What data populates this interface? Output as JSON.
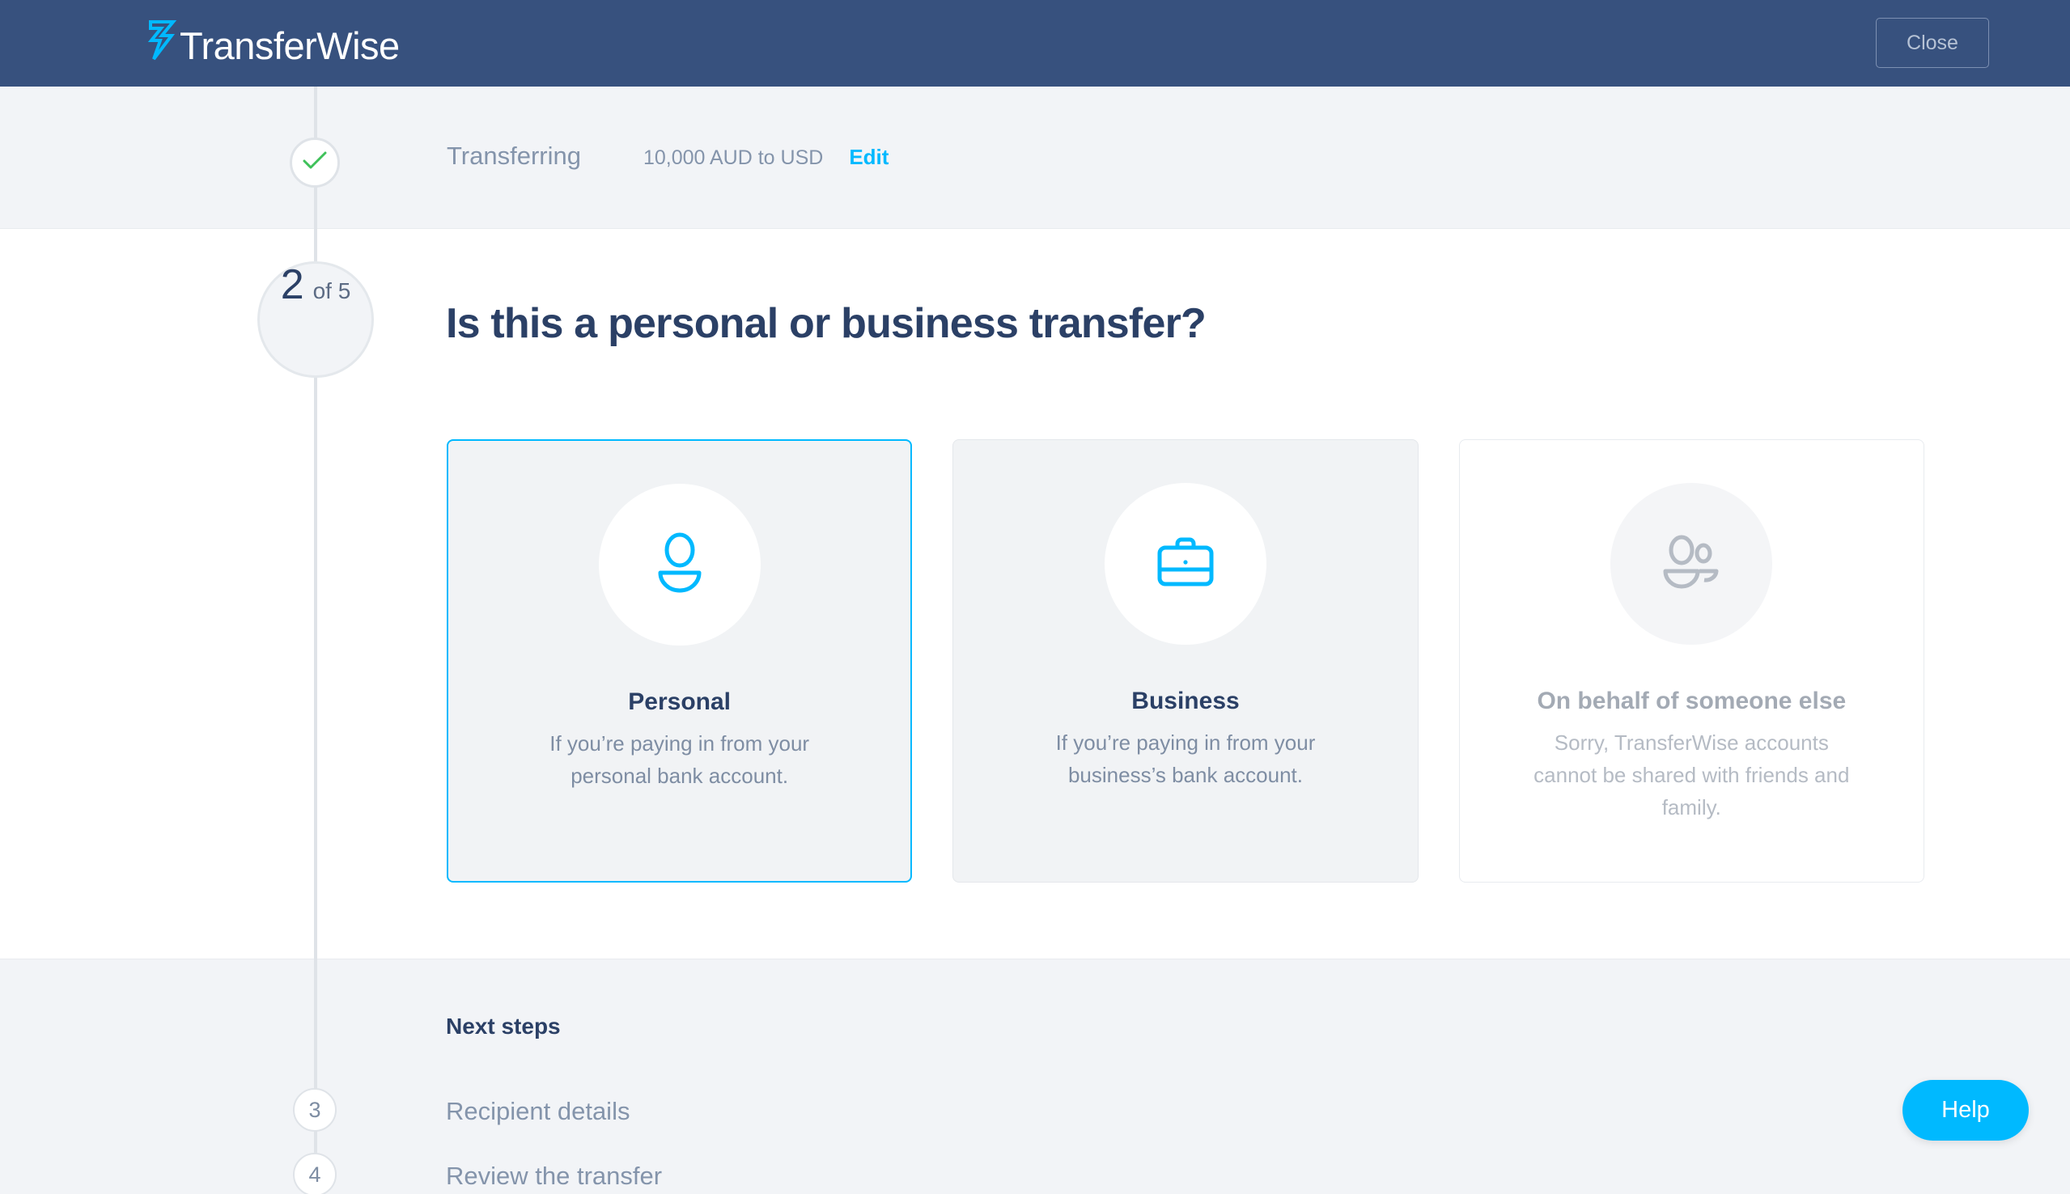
{
  "header": {
    "logo_text": "TransferWise",
    "logo_icon": "transferwise-arrows-logo",
    "close_label": "Close",
    "background_color": "#37517e"
  },
  "transfer_summary": {
    "label": "Transferring",
    "amount": "10,000 AUD to USD",
    "edit_label": "Edit",
    "edit_color": "#00b9ff",
    "status_icon": "check-icon",
    "check_color": "#3fc15a"
  },
  "progress": {
    "current_step": "2",
    "of_label": "of 5",
    "total": 5
  },
  "main": {
    "heading": "Is this a personal or business transfer?",
    "cards": [
      {
        "id": "personal",
        "icon": "person-icon",
        "title": "Personal",
        "description": "If you’re paying in from your personal bank account.",
        "selected": true,
        "disabled": false,
        "accent_color": "#00b9ff"
      },
      {
        "id": "business",
        "icon": "briefcase-icon",
        "title": "Business",
        "description": "If you’re paying in from your business’s bank account.",
        "selected": false,
        "disabled": false,
        "accent_color": "#00b9ff"
      },
      {
        "id": "on-behalf",
        "icon": "people-group-icon",
        "title": "On behalf of someone else",
        "description": "Sorry, TransferWise accounts cannot be shared with friends and family.",
        "selected": false,
        "disabled": true,
        "accent_color": "#b5bbc4"
      }
    ]
  },
  "next_steps": {
    "title": "Next steps",
    "items": [
      {
        "number": "3",
        "label": "Recipient details"
      },
      {
        "number": "4",
        "label": "Review the transfer"
      }
    ]
  },
  "help": {
    "label": "Help",
    "color": "#00b9ff"
  }
}
